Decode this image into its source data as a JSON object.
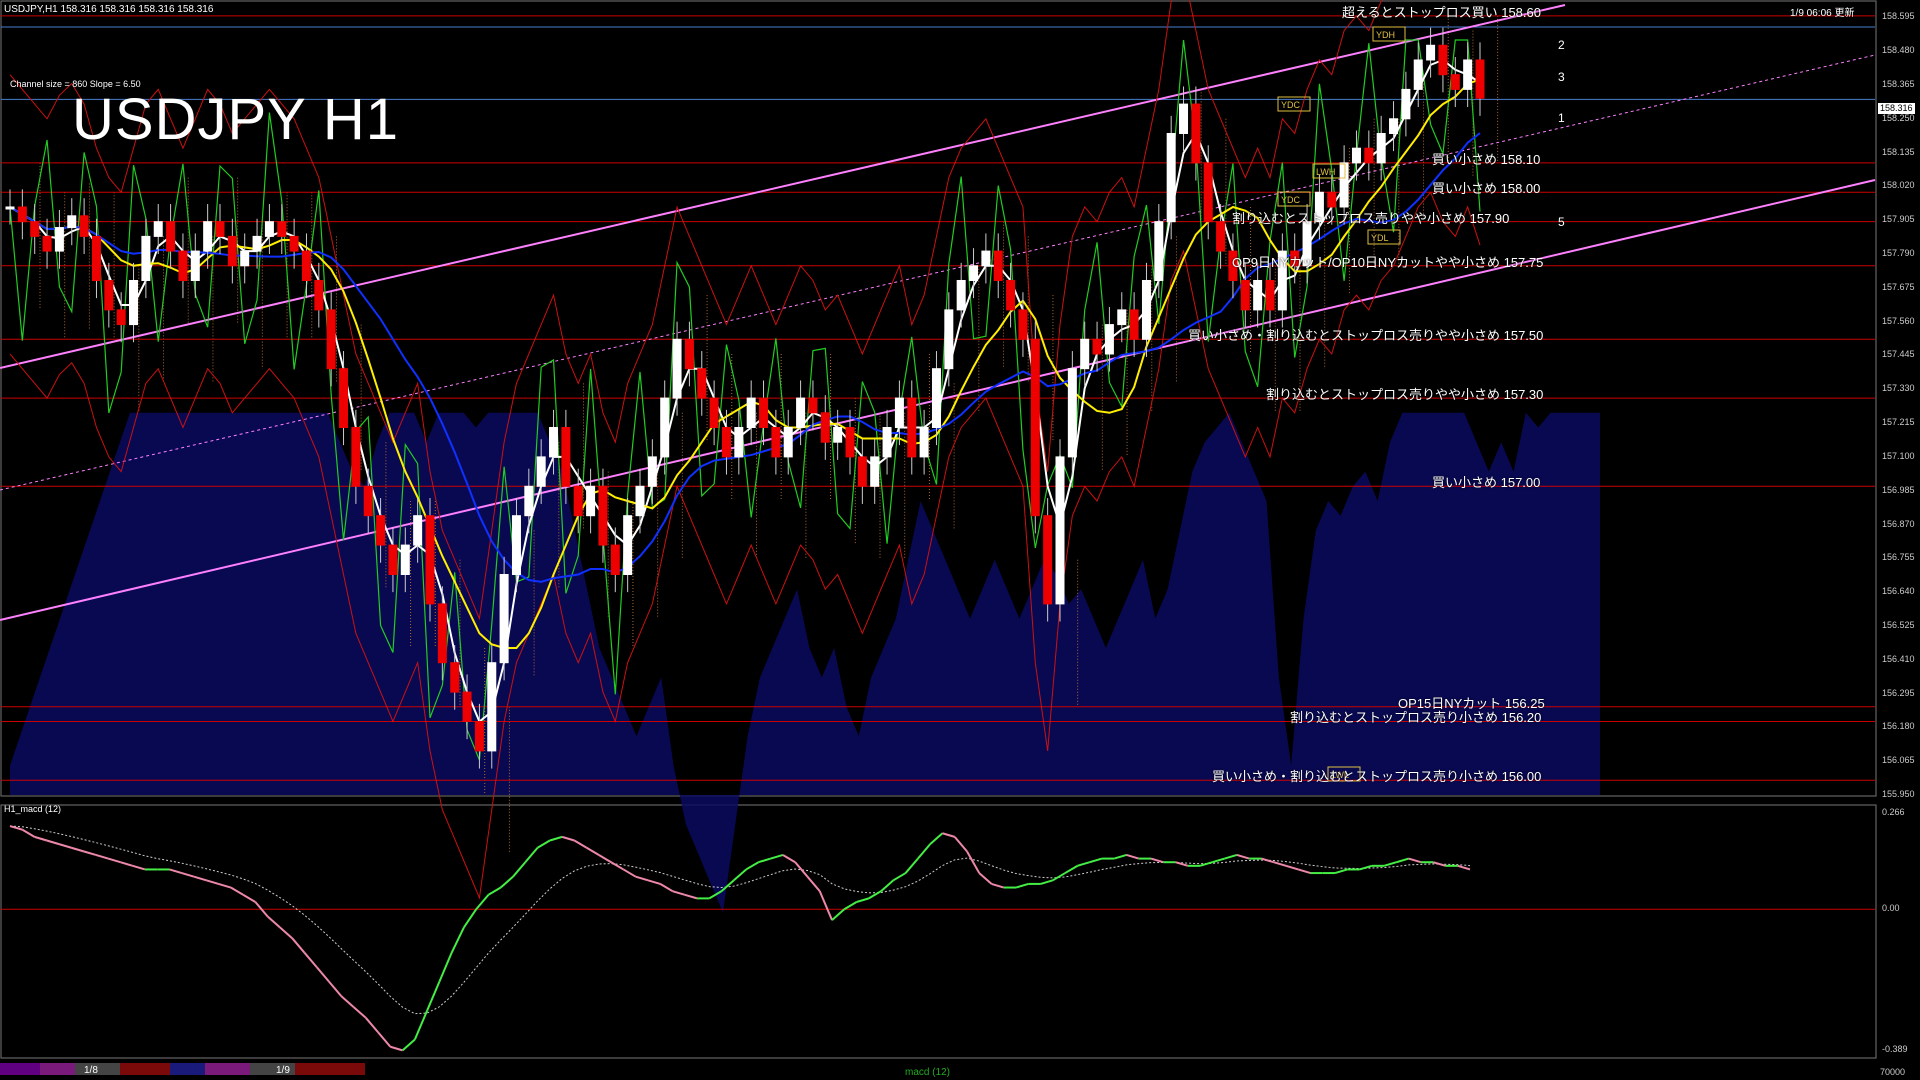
{
  "window": {
    "header": "USDJPY,H1  158.316 158.316 158.316 158.316",
    "big_title": "USDJPY H1",
    "clock": "1/9 06:06 更新",
    "channel_info": "Channel size = 860 Slope = 6.50",
    "macd_label": "H1_macd (12)",
    "current_price": "158.316"
  },
  "levels": [
    {
      "price": 158.6,
      "label": "超えるとストップロス買い 158.60"
    },
    {
      "price": 158.1,
      "label": "買い小さめ 158.10"
    },
    {
      "price": 158.0,
      "label": "買い小さめ 158.00"
    },
    {
      "price": 157.9,
      "label": "割り込むとストップロス売りやや小さめ 157.90"
    },
    {
      "price": 157.75,
      "label": "OP9日NYカット/OP10日NYカットやや小さめ 157.75"
    },
    {
      "price": 157.5,
      "label": "買い小さめ・割り込むとストップロス売りやや小さめ 157.50"
    },
    {
      "price": 157.3,
      "label": "割り込むとストップロス売りやや小さめ 157.30"
    },
    {
      "price": 157.0,
      "label": "買い小さめ 157.00"
    },
    {
      "price": 156.25,
      "label": "OP15日NYカット 156.25"
    },
    {
      "price": 156.2,
      "label": "割り込むとストップロス売り小さめ 156.20"
    },
    {
      "price": 156.0,
      "label": "買い小さめ・割り込むとストップロス売り小さめ 156.00"
    }
  ],
  "axis": {
    "price_ticks": [
      "158.595",
      "158.480",
      "158.365",
      "158.250",
      "158.135",
      "158.020",
      "157.905",
      "157.790",
      "157.675",
      "157.560",
      "157.445",
      "157.330",
      "157.215",
      "157.100",
      "156.985",
      "156.870",
      "156.755",
      "156.640",
      "156.525",
      "156.410",
      "156.295",
      "156.180",
      "156.065",
      "155.950"
    ],
    "macd_ticks": [
      "0.266",
      "0.00",
      "-0.389"
    ],
    "date_labels": [
      "1/8",
      "1/9"
    ],
    "right_label": "70000",
    "macd_footer": "macd (12)"
  },
  "markers": [
    "YDH",
    "YDC",
    "YDC",
    "YDL",
    "LWH",
    "LWL"
  ],
  "channel_numbers": [
    "2",
    "3",
    "1",
    "5"
  ],
  "chart_data": {
    "type": "line",
    "title": "USDJPY H1",
    "ylim": [
      155.95,
      158.62
    ],
    "x": [
      0,
      1,
      2,
      3,
      4,
      5,
      6,
      7,
      8,
      9,
      10,
      11,
      12,
      13,
      14,
      15,
      16,
      17,
      18,
      19,
      20,
      21,
      22,
      23,
      24,
      25,
      26,
      27,
      28,
      29,
      30,
      31,
      32,
      33,
      34,
      35,
      36,
      37,
      38,
      39,
      40,
      41,
      42,
      43,
      44,
      45,
      46,
      47,
      48,
      49,
      50,
      51,
      52,
      53,
      54,
      55,
      56,
      57,
      58,
      59,
      60,
      61,
      62,
      63,
      64,
      65,
      66,
      67,
      68,
      69,
      70,
      71,
      72,
      73,
      74,
      75,
      76,
      77,
      78,
      79,
      80,
      81,
      82,
      83,
      84,
      85,
      86,
      87,
      88,
      89,
      90,
      91,
      92,
      93,
      94,
      95,
      96,
      97,
      98,
      99,
      100,
      101,
      102,
      103,
      104,
      105,
      106,
      107,
      108,
      109,
      110,
      111,
      112,
      113,
      114,
      115,
      116,
      117,
      118,
      119
    ],
    "series": [
      {
        "values": [
          157.95,
          157.9,
          157.85,
          157.8,
          157.88,
          157.92,
          157.85,
          157.7,
          157.6,
          157.55,
          157.7,
          157.85,
          157.9,
          157.8,
          157.7,
          157.8,
          157.9,
          157.85,
          157.75,
          157.8,
          157.85,
          157.9,
          157.85,
          157.8,
          157.7,
          157.6,
          157.4,
          157.2,
          157.0,
          156.9,
          156.8,
          156.7,
          156.8,
          156.9,
          156.6,
          156.4,
          156.3,
          156.2,
          156.1,
          156.4,
          156.7,
          156.9,
          157.0,
          157.1,
          157.2,
          157.0,
          156.9,
          157.0,
          156.8,
          156.7,
          156.9,
          157.0,
          157.1,
          157.3,
          157.5,
          157.4,
          157.3,
          157.2,
          157.1,
          157.2,
          157.3,
          157.2,
          157.1,
          157.2,
          157.3,
          157.25,
          157.15,
          157.2,
          157.1,
          157.0,
          157.1,
          157.2,
          157.3,
          157.1,
          157.2,
          157.4,
          157.6,
          157.7,
          157.75,
          157.8,
          157.7,
          157.6,
          157.5,
          156.9,
          156.6,
          157.1,
          157.4,
          157.5,
          157.45,
          157.55,
          157.6,
          157.5,
          157.7,
          157.9,
          158.2,
          158.3,
          158.1,
          157.9,
          157.8,
          157.7,
          157.6,
          157.7,
          157.6,
          157.8,
          157.75,
          157.9,
          158.0,
          157.95,
          158.1,
          158.15,
          158.1,
          158.2,
          158.25,
          158.35,
          158.45,
          158.5,
          158.4,
          158.35,
          158.45,
          158.32
        ]
      }
    ],
    "macd": [
      0.23,
      0.22,
      0.2,
      0.19,
      0.18,
      0.17,
      0.16,
      0.15,
      0.14,
      0.13,
      0.12,
      0.11,
      0.11,
      0.11,
      0.1,
      0.09,
      0.08,
      0.07,
      0.06,
      0.04,
      0.02,
      -0.02,
      -0.05,
      -0.08,
      -0.12,
      -0.16,
      -0.2,
      -0.24,
      -0.27,
      -0.3,
      -0.34,
      -0.38,
      -0.39,
      -0.36,
      -0.28,
      -0.2,
      -0.12,
      -0.05,
      0.0,
      0.04,
      0.06,
      0.09,
      0.13,
      0.17,
      0.19,
      0.2,
      0.19,
      0.17,
      0.15,
      0.13,
      0.11,
      0.09,
      0.08,
      0.07,
      0.05,
      0.04,
      0.03,
      0.03,
      0.05,
      0.08,
      0.11,
      0.13,
      0.14,
      0.15,
      0.13,
      0.09,
      0.05,
      -0.03,
      0.0,
      0.02,
      0.03,
      0.05,
      0.08,
      0.1,
      0.14,
      0.18,
      0.21,
      0.2,
      0.16,
      0.1,
      0.07,
      0.06,
      0.06,
      0.07,
      0.07,
      0.08,
      0.1,
      0.12,
      0.13,
      0.14,
      0.14,
      0.15,
      0.14,
      0.14,
      0.13,
      0.13,
      0.12,
      0.12,
      0.13,
      0.14,
      0.15,
      0.14,
      0.14,
      0.13,
      0.12,
      0.11,
      0.1,
      0.1,
      0.1,
      0.11,
      0.11,
      0.12,
      0.12,
      0.13,
      0.14,
      0.13,
      0.13,
      0.12,
      0.12,
      0.11
    ]
  }
}
